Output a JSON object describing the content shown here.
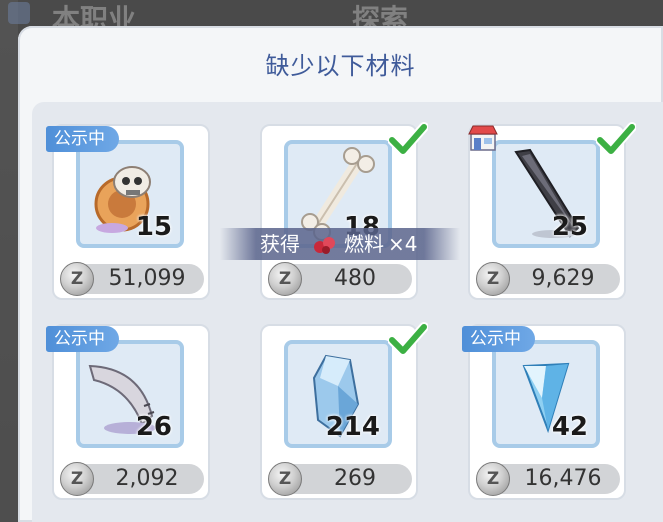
{
  "background": {
    "tab_left": "本职业",
    "tab_right": "探索"
  },
  "dialog": {
    "title": "缺少以下材料"
  },
  "items": [
    {
      "quantity": "15",
      "price": "51,099",
      "badge": "公示中",
      "checked": false,
      "shop": false,
      "icon": "skull-wheel-icon"
    },
    {
      "quantity": "18",
      "price": "480",
      "badge": "",
      "checked": true,
      "shop": false,
      "icon": "bone-icon"
    },
    {
      "quantity": "25",
      "price": "9,629",
      "badge": "",
      "checked": true,
      "shop": true,
      "icon": "blade-icon"
    },
    {
      "quantity": "26",
      "price": "2,092",
      "badge": "公示中",
      "checked": false,
      "shop": false,
      "icon": "horn-icon"
    },
    {
      "quantity": "214",
      "price": "269",
      "badge": "",
      "checked": true,
      "shop": false,
      "icon": "blue-crystal-icon"
    },
    {
      "quantity": "42",
      "price": "16,476",
      "badge": "公示中",
      "checked": false,
      "shop": false,
      "icon": "ice-crystal-icon"
    }
  ],
  "currency_symbol": "Z",
  "toast": {
    "prefix": "获得",
    "item": "燃料",
    "count": "×4"
  },
  "colors": {
    "title": "#3f5b9a",
    "badge": "#4f8fd8",
    "check": "#3cb043"
  }
}
